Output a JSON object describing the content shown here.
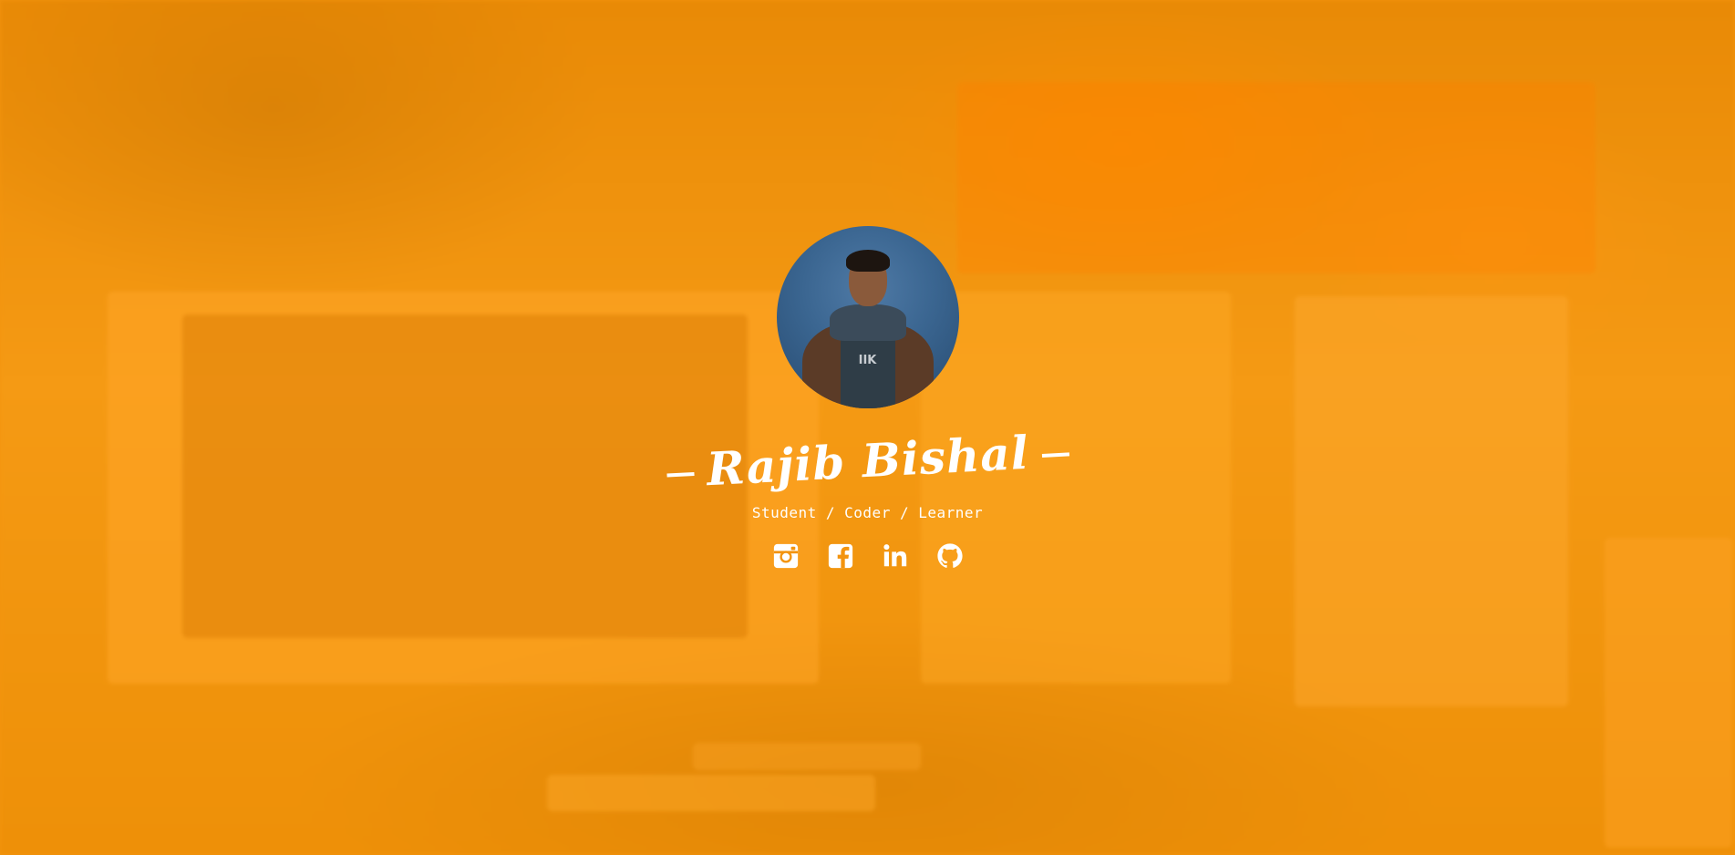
{
  "profile": {
    "name": "Rajib Bishal",
    "tagline": "Student / Coder / Learner",
    "avatar_icon": "profile-photo"
  },
  "socials": [
    {
      "name": "instagram",
      "icon": "instagram-icon"
    },
    {
      "name": "facebook",
      "icon": "facebook-icon"
    },
    {
      "name": "linkedin",
      "icon": "linkedin-icon"
    },
    {
      "name": "github",
      "icon": "github-icon"
    }
  ],
  "colors": {
    "background": "#f3940f",
    "text": "#ffffff",
    "avatar_bg": "#3a6590"
  }
}
